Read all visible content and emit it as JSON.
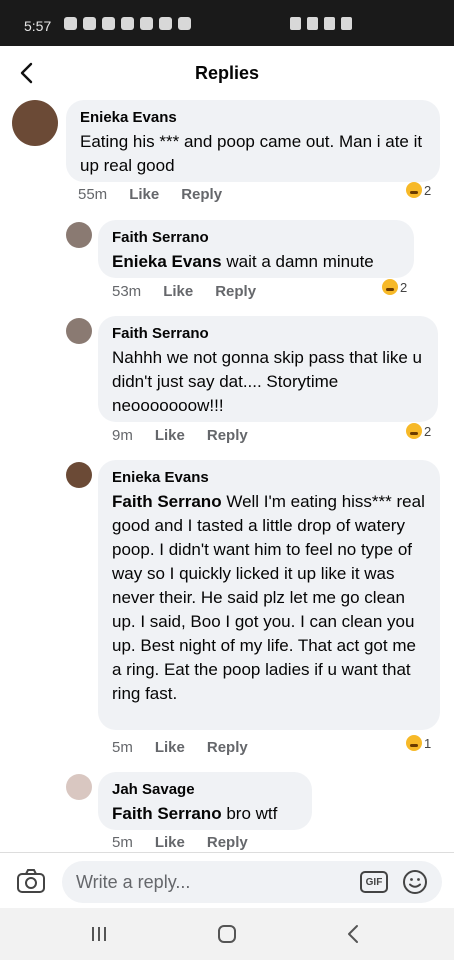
{
  "status_bar": {
    "time": "5:57"
  },
  "header": {
    "title": "Replies"
  },
  "comments": [
    {
      "author": "Enieka Evans",
      "mention": "",
      "text": "Eating his *** and poop came out. Man i ate it up real good",
      "time": "55m",
      "like_label": "Like",
      "reply_label": "Reply",
      "reaction_count": "2"
    },
    {
      "author": "Faith Serrano",
      "mention": "Enieka Evans",
      "text": "wait a damn minute",
      "time": "53m",
      "like_label": "Like",
      "reply_label": "Reply",
      "reaction_count": "2"
    },
    {
      "author": "Faith Serrano",
      "mention": "",
      "text": "Nahhh we not gonna skip pass that like u didn't just say dat.... Storytime neooooooow!!!",
      "time": "9m",
      "like_label": "Like",
      "reply_label": "Reply",
      "reaction_count": "2"
    },
    {
      "author": "Enieka Evans",
      "mention": "Faith Serrano",
      "text": "Well I'm eating hiss*** real good and I tasted a little drop of watery poop. I didn't want him to feel no type of way so I quickly licked it up like it was never their. He said plz let me go clean up. I said, Boo I got you. I can clean you up. Best night of my life. That act got me a ring. Eat the poop ladies if u want that ring fast.",
      "time": "5m",
      "like_label": "Like",
      "reply_label": "Reply",
      "reaction_count": "1"
    },
    {
      "author": "Jah Savage",
      "mention": "Faith Serrano",
      "text": "bro wtf",
      "time": "5m",
      "like_label": "Like",
      "reply_label": "Reply",
      "reaction_count": ""
    }
  ],
  "composer": {
    "placeholder": "Write a reply...",
    "gif_label": "GIF"
  },
  "colors": {
    "bubble": "#f0f2f5",
    "meta": "#65676b",
    "reaction": "#f7b928"
  }
}
